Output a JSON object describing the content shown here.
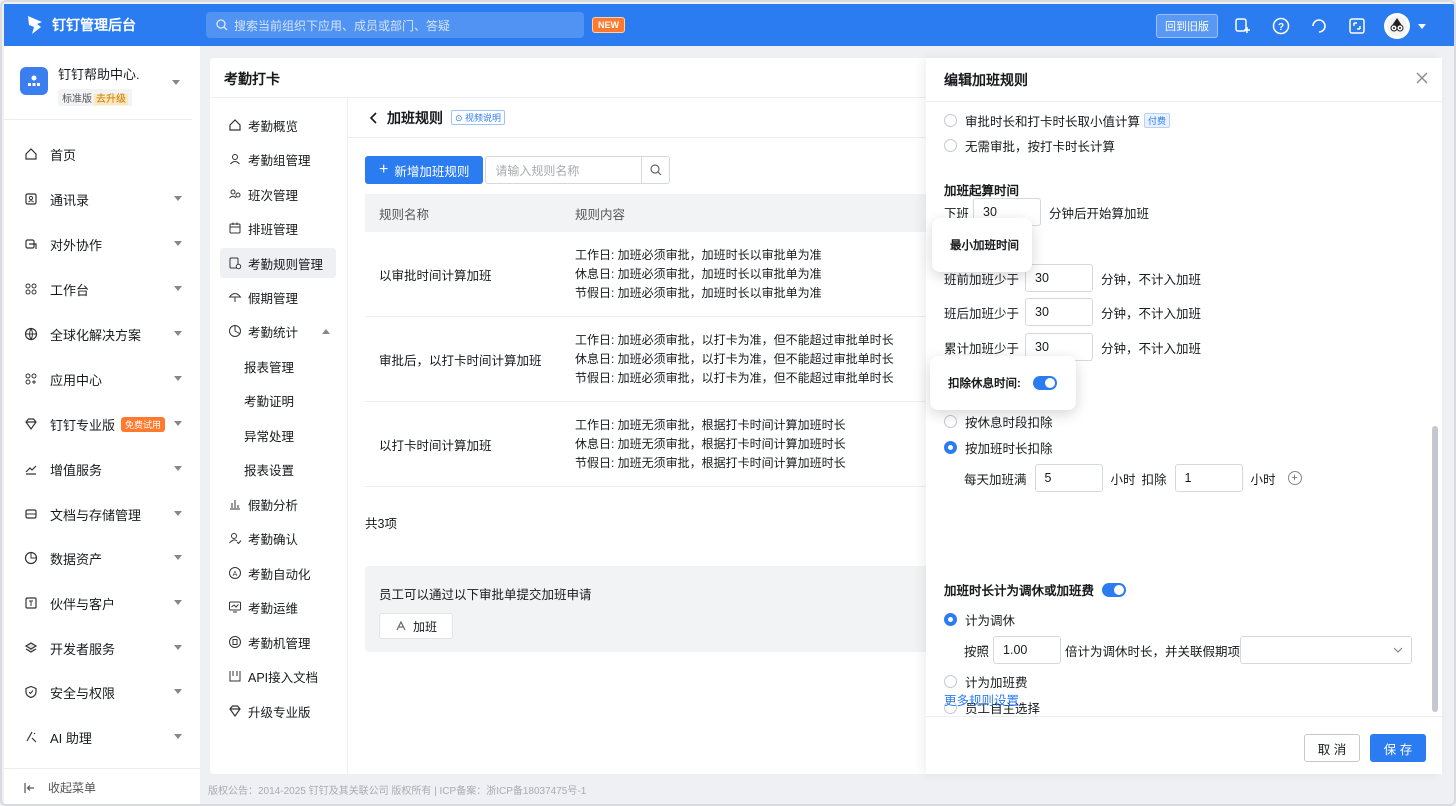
{
  "topbar": {
    "app_title": "钉钉管理后台",
    "search_placeholder": "搜索当前组织下应用、成员或部门、答疑",
    "new_badge": "NEW",
    "old_version_button": "回到旧版"
  },
  "sidebar": {
    "org_name": "钉钉帮助中心.",
    "org_edition": "标准版",
    "org_upgrade": "去升级",
    "items": [
      {
        "label": "首页",
        "icon": "home-icon",
        "caret": false
      },
      {
        "label": "通讯录",
        "icon": "contacts-icon",
        "caret": true
      },
      {
        "label": "对外协作",
        "icon": "collab-icon",
        "caret": true
      },
      {
        "label": "工作台",
        "icon": "grid-icon",
        "caret": true
      },
      {
        "label": "全球化解决方案",
        "icon": "globe-icon",
        "caret": true
      },
      {
        "label": "应用中心",
        "icon": "apps-icon",
        "caret": true
      },
      {
        "label": "钉钉专业版",
        "icon": "diamond-icon",
        "caret": true,
        "badge": "免费试用"
      },
      {
        "label": "增值服务",
        "icon": "trend-icon",
        "caret": true
      },
      {
        "label": "文档与存储管理",
        "icon": "storage-icon",
        "caret": true
      },
      {
        "label": "数据资产",
        "icon": "data-icon",
        "caret": true
      },
      {
        "label": "伙伴与客户",
        "icon": "partner-icon",
        "caret": true
      },
      {
        "label": "开发者服务",
        "icon": "layers-icon",
        "caret": true
      },
      {
        "label": "安全与权限",
        "icon": "shield-icon",
        "caret": true
      },
      {
        "label": "AI 助理",
        "icon": "ai-icon",
        "caret": true
      }
    ],
    "collapse_label": "收起菜单"
  },
  "footer": {
    "text": "版权公告：2014-2025 钉钉及其关联公司 版权所有 | ICP备案：浙ICP备18037475号-1"
  },
  "main": {
    "title": "考勤打卡",
    "subnav": [
      {
        "label": "考勤概览",
        "icon": "home-icon"
      },
      {
        "label": "考勤组管理",
        "icon": "user-icon"
      },
      {
        "label": "班次管理",
        "icon": "users-icon"
      },
      {
        "label": "排班管理",
        "icon": "calendar-icon"
      },
      {
        "label": "考勤规则管理",
        "icon": "rules-icon",
        "active": true
      },
      {
        "label": "假期管理",
        "icon": "umbrella-icon"
      },
      {
        "label": "考勤统计",
        "icon": "chart-icon",
        "expanded": true
      },
      {
        "label": "报表管理",
        "sub": true
      },
      {
        "label": "考勤证明",
        "sub": true
      },
      {
        "label": "异常处理",
        "sub": true
      },
      {
        "label": "报表设置",
        "sub": true
      },
      {
        "label": "假勤分析",
        "icon": "bar-icon"
      },
      {
        "label": "考勤确认",
        "icon": "user-check-icon"
      },
      {
        "label": "考勤自动化",
        "icon": "auto-icon"
      },
      {
        "label": "考勤运维",
        "icon": "monitor-icon"
      },
      {
        "label": "考勤机管理",
        "icon": "device-icon"
      },
      {
        "label": "API接入文档",
        "icon": "doc-icon"
      },
      {
        "label": "升级专业版",
        "icon": "diamond-icon"
      }
    ],
    "page_title": "加班规则",
    "video_tag": "视频说明",
    "add_button": "新增加班规则",
    "search_placeholder": "请输入规则名称",
    "table": {
      "headers": [
        "规则名称",
        "规则内容"
      ],
      "rows": [
        {
          "name": "以审批时间计算加班",
          "lines": [
            "工作日: 加班必须审批，加班时长以审批单为准",
            "休息日: 加班必须审批，加班时长以审批单为准",
            "节假日: 加班必须审批，加班时长以审批单为准"
          ]
        },
        {
          "name": "审批后，以打卡时间计算加班",
          "lines": [
            "工作日: 加班必须审批，以打卡为准，但不能超过审批单时长",
            "休息日: 加班必须审批，以打卡为准，但不能超过审批单时长",
            "节假日: 加班必须审批，以打卡为准，但不能超过审批单时长"
          ]
        },
        {
          "name": "以打卡时间计算加班",
          "lines": [
            "工作日: 加班无须审批，根据打卡时间计算加班时长",
            "休息日: 加班无须审批，根据打卡时间计算加班时长",
            "节假日: 加班无须审批，根据打卡时间计算加班时长"
          ]
        }
      ]
    },
    "total": "共3项",
    "apply_text": "员工可以通过以下审批单提交加班申请",
    "apply_button": "加班"
  },
  "drawer": {
    "title": "编辑加班规则",
    "opt_min": "审批时长和打卡时长取小值计算",
    "fee_tag": "付费",
    "opt_no_approval": "无需审批，按打卡时长计算",
    "start_title": "加班起算时间",
    "start_prefix": "下班",
    "start_value": "30",
    "start_suffix": "分钟后开始算加班",
    "min_tip": "最小加班时间",
    "before_label": "班前加班少于",
    "before_value": "30",
    "before_suffix": "分钟，不计入加班",
    "after_label": "班后加班少于",
    "after_value": "30",
    "after_suffix": "分钟，不计入加班",
    "cum_label": "累计加班少于",
    "cum_value": "30",
    "cum_suffix": "分钟，不计入加班",
    "deduct_tip": "扣除休息时间:",
    "deduct_by_period": "按休息时段扣除",
    "deduct_by_duration": "按加班时长扣除",
    "daily_label": "每天加班满",
    "daily_value": "5",
    "daily_unit": "小时",
    "deduct_word": "扣除",
    "deduct_value": "1",
    "deduct_unit": "小时",
    "comp_title": "加班时长计为调休或加班费",
    "comp_leave": "计为调休",
    "ratio_prefix": "按照",
    "ratio_value": "1.00",
    "ratio_suffix": "倍计为调休时长，并关联假期项",
    "comp_pay": "计为加班费",
    "comp_self": "员工自主选择",
    "more_link": "更多规则设置",
    "cancel": "取 消",
    "save": "保 存"
  },
  "colors": {
    "brand": "#2b7cf0",
    "badge": "#ff7a2e"
  }
}
